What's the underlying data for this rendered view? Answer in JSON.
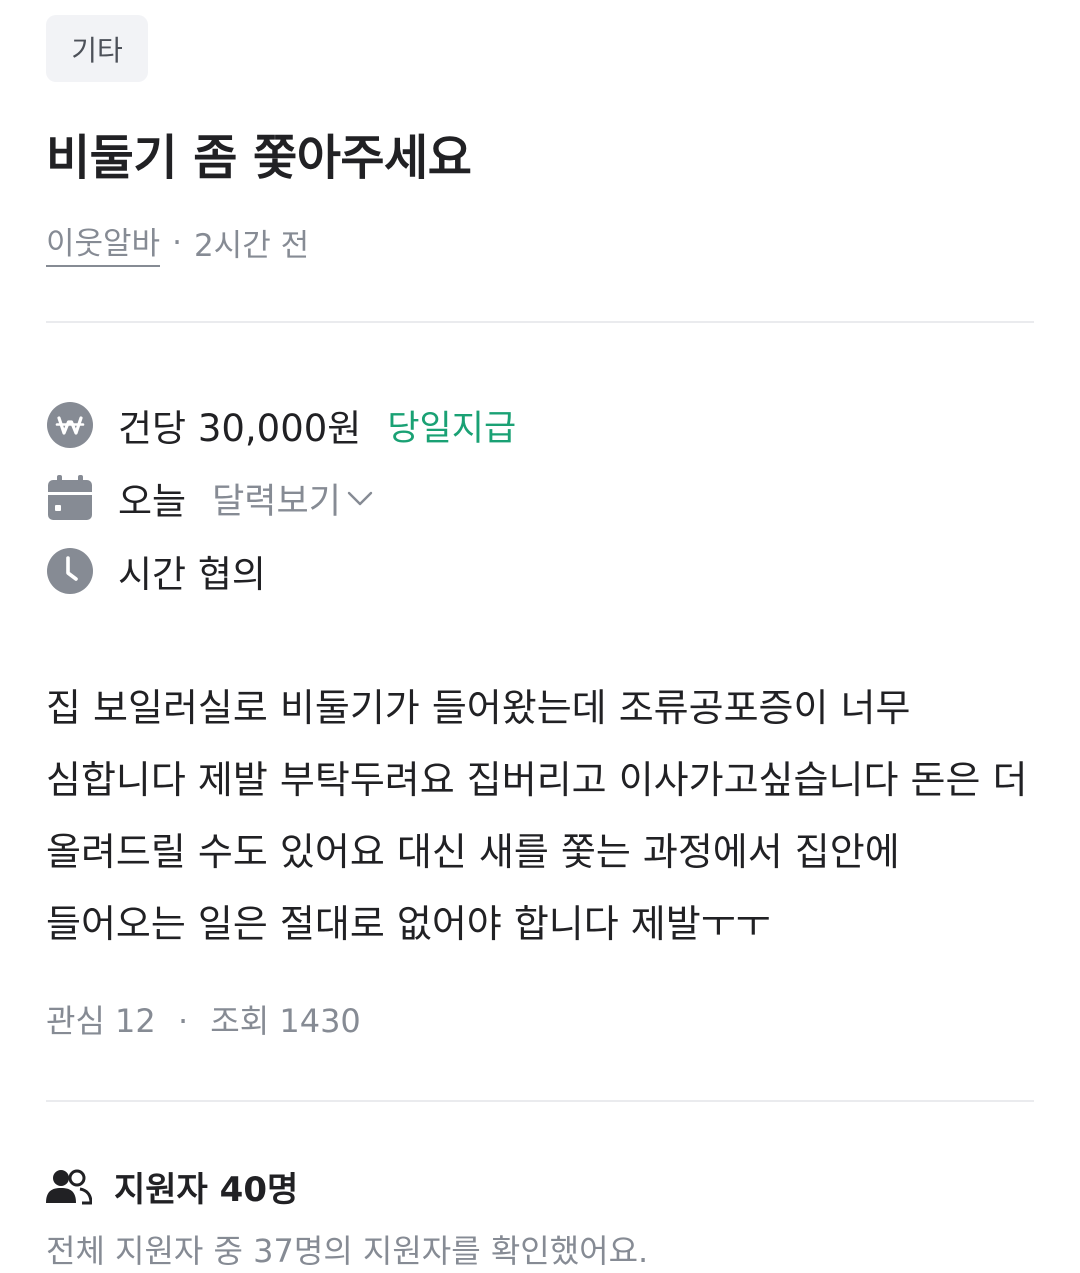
{
  "category": "기타",
  "title": "비둘기 좀 쫓아주세요",
  "meta": {
    "author": "이웃알바",
    "separator": "·",
    "time": "2시간 전"
  },
  "info": {
    "pay": "건당 30,000원",
    "pay_badge": "당일지급",
    "date": "오늘",
    "calendar_link": "달력보기",
    "time": "시간 협의"
  },
  "body": "집 보일러실로 비둘기가 들어왔는데 조류공포증이 너무 심합니다 제발 부탁두려요 집버리고 이사가고싶습니다 돈은 더 올려드릴 수도 있어요 대신 새를 쫓는 과정에서 집안에 들어오는 일은 절대로 없어야 합니다 제발ㅜㅜ",
  "stats": {
    "interest_label": "관심 12",
    "separator": "·",
    "views_label": "조회 1430"
  },
  "applicants": {
    "title": "지원자 40명",
    "description": "전체 지원자 중 37명의 지원자를 확인했어요."
  },
  "colors": {
    "text_primary": "#212124",
    "text_secondary": "#868b94",
    "pay_badge": "#1aa174",
    "icon_gray": "#868b94",
    "badge_bg": "#f2f3f6",
    "divider": "#eaebee"
  },
  "icons": {
    "pay": "won-icon",
    "date": "calendar-icon",
    "time": "clock-icon",
    "calendar_link": "chevron-down-icon",
    "applicants": "users-icon"
  }
}
